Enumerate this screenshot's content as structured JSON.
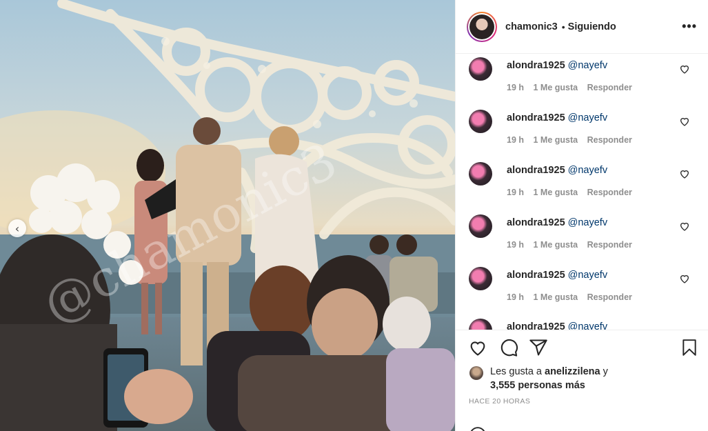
{
  "header": {
    "username": "chamonic3",
    "separator": "•",
    "follow_status": "Siguiendo",
    "more": "•••"
  },
  "comments": [
    {
      "user": "alondra1925",
      "mention": "@nayefv",
      "time": "19 h",
      "likes": "1 Me gusta",
      "reply": "Responder"
    },
    {
      "user": "alondra1925",
      "mention": "@nayefv",
      "time": "19 h",
      "likes": "1 Me gusta",
      "reply": "Responder"
    },
    {
      "user": "alondra1925",
      "mention": "@nayefv",
      "time": "19 h",
      "likes": "1 Me gusta",
      "reply": "Responder"
    },
    {
      "user": "alondra1925",
      "mention": "@nayefv",
      "time": "19 h",
      "likes": "1 Me gusta",
      "reply": "Responder"
    },
    {
      "user": "alondra1925",
      "mention": "@nayefv",
      "time": "19 h",
      "likes": "1 Me gusta",
      "reply": "Responder"
    },
    {
      "user": "alondra1925",
      "mention": "@nayefv",
      "time": "",
      "likes": "",
      "reply": ""
    }
  ],
  "likes": {
    "prefix": "Les gusta a",
    "user": "anelizzilena",
    "conjunction": "y",
    "count": "3,555 personas más"
  },
  "timestamp": "HACE 20 HORAS",
  "watermark": "@chamonic3",
  "icons": {
    "like": "heart-icon",
    "comment": "comment-icon",
    "share": "share-icon",
    "save": "bookmark-icon",
    "prev": "chevron-left-icon"
  },
  "prev_glyph": "‹"
}
